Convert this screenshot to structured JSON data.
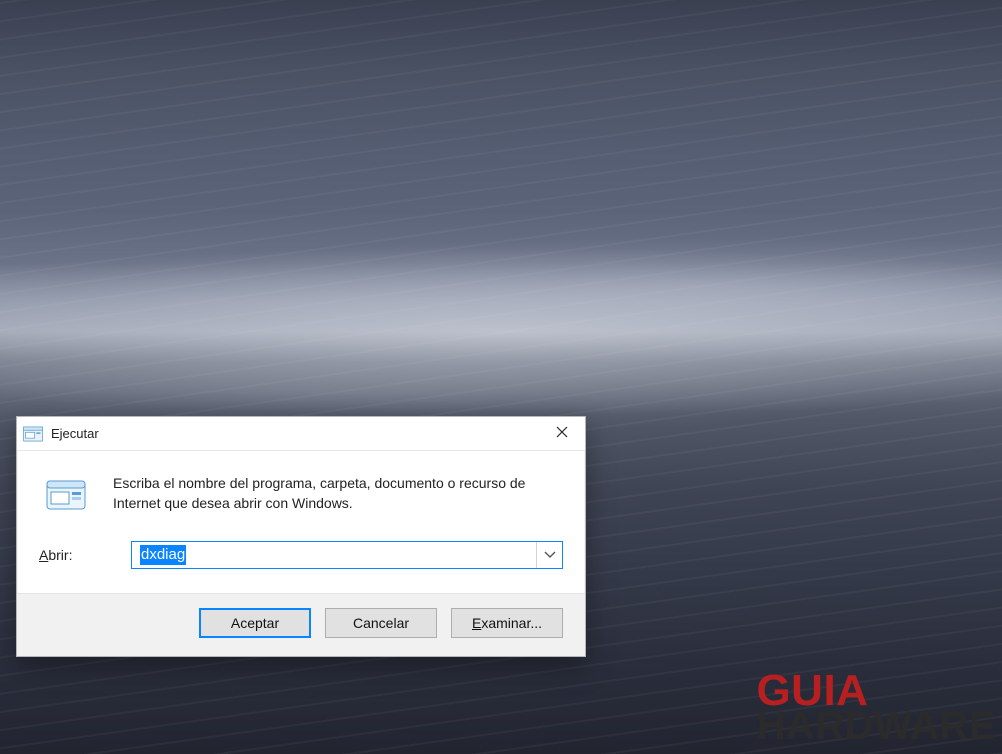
{
  "watermark": {
    "top": "GUIA",
    "bottom": "HARDWARE"
  },
  "dialog": {
    "title": "Ejecutar",
    "description": "Escriba el nombre del programa, carpeta, documento o recurso de Internet que desea abrir con Windows.",
    "open_label_prefix": "A",
    "open_label_rest": "brir:",
    "input_value": "dxdiag",
    "buttons": {
      "ok": "Aceptar",
      "cancel": "Cancelar",
      "browse_prefix": "E",
      "browse_rest": "xaminar..."
    },
    "icons": {
      "window_icon": "run-window-icon",
      "close": "close-icon",
      "chevron": "chevron-down-icon"
    }
  }
}
